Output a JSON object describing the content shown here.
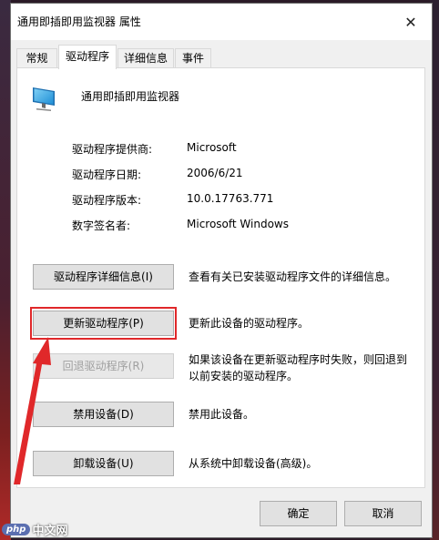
{
  "window": {
    "title": "通用即插即用监视器 属性",
    "close_glyph": "✕"
  },
  "tabs": [
    {
      "label": "常规"
    },
    {
      "label": "驱动程序"
    },
    {
      "label": "详细信息"
    },
    {
      "label": "事件"
    }
  ],
  "device": {
    "name": "通用即插即用监视器",
    "icon": "monitor-icon"
  },
  "info": {
    "provider_label": "驱动程序提供商:",
    "provider_value": "Microsoft",
    "date_label": "驱动程序日期:",
    "date_value": "2006/6/21",
    "version_label": "驱动程序版本:",
    "version_value": "10.0.17763.771",
    "signer_label": "数字签名者:",
    "signer_value": "Microsoft Windows"
  },
  "actions": {
    "details_label": "驱动程序详细信息(I)",
    "details_desc": "查看有关已安装驱动程序文件的详细信息。",
    "update_label": "更新驱动程序(P)",
    "update_desc": "更新此设备的驱动程序。",
    "rollback_label": "回退驱动程序(R)",
    "rollback_desc": "如果该设备在更新驱动程序时失败，则回退到以前安装的驱动程序。",
    "disable_label": "禁用设备(D)",
    "disable_desc": "禁用此设备。",
    "uninstall_label": "卸载设备(U)",
    "uninstall_desc": "从系统中卸载设备(高级)。"
  },
  "footer": {
    "ok_label": "确定",
    "cancel_label": "取消"
  },
  "watermark": {
    "badge": "php",
    "text": "中文网"
  },
  "colors": {
    "highlight": "#e0282a",
    "arrow": "#e0282a"
  }
}
